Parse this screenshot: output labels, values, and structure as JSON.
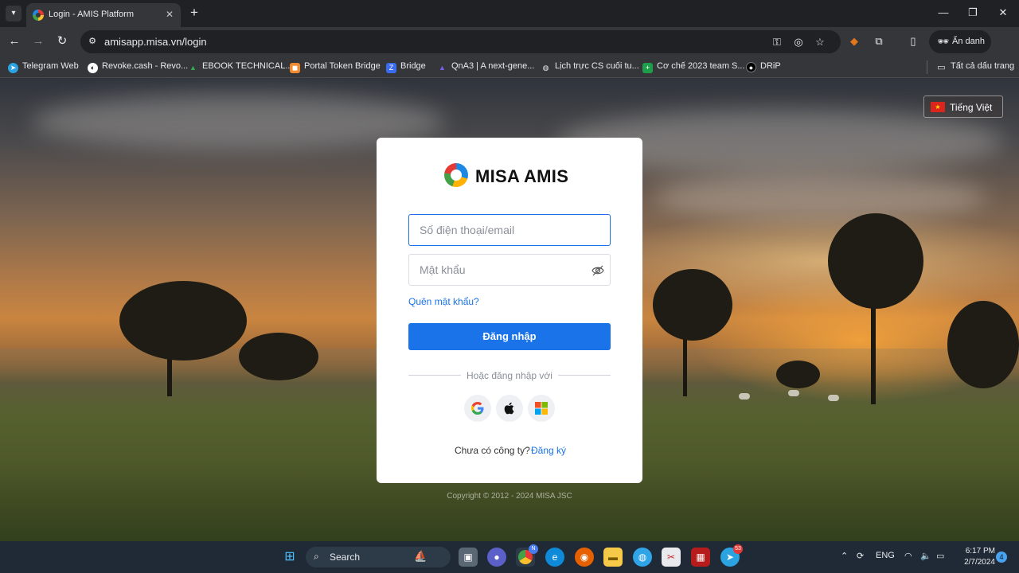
{
  "browser": {
    "tab_title": "Login - AMIS Platform",
    "url": "amisapp.misa.vn/login",
    "incognito_label": "Ẩn danh",
    "bookmarks": [
      {
        "label": "Telegram Web",
        "icon_color": "#2aa3e0",
        "glyph": "➤"
      },
      {
        "label": "Revoke.cash - Revo...",
        "icon_color": "#ffffff",
        "glyph": "◐"
      },
      {
        "label": "EBOOK TECHNICAL...",
        "icon_color": "#34a853",
        "glyph": "▲"
      },
      {
        "label": "Portal Token Bridge",
        "icon_color": "#f28b30",
        "glyph": "◼"
      },
      {
        "label": "Bridge",
        "icon_color": "#3b6cf0",
        "glyph": "Z"
      },
      {
        "label": "QnA3 | A next-gene...",
        "icon_color": "#5b3fd0",
        "glyph": "▲"
      },
      {
        "label": "Lịch trực CS cuối tu...",
        "icon_color": "#e8eaed",
        "glyph": "◍"
      },
      {
        "label": "Cơ chế 2023 team S...",
        "icon_color": "#1e9e4a",
        "glyph": "+"
      },
      {
        "label": "DRiP",
        "icon_color": "#000000",
        "glyph": "●"
      }
    ],
    "all_bookmarks_label": "Tất cả dấu trang"
  },
  "page": {
    "language_label": "Tiếng Việt",
    "logo_text": "MISA AMIS",
    "username_placeholder": "Số điện thoại/email",
    "username_value": "",
    "password_placeholder": "Mật khẩu",
    "password_value": "",
    "forgot_password": "Quên mật khẩu?",
    "login_button": "Đăng nhập",
    "divider_text": "Hoặc đăng nhập với",
    "signup_question": "Chưa có công ty?",
    "signup_link": "Đăng ký",
    "copyright": "Copyright © 2012 - 2024 MISA JSC"
  },
  "taskbar": {
    "search_label": "Search",
    "language": "ENG",
    "time": "6:17 PM",
    "date": "2/7/2024",
    "notification_count": "4",
    "chrome_badge": "N",
    "telegram_badge": "53"
  },
  "colors": {
    "primary": "#1a73e8",
    "chrome_dark": "#202124",
    "chrome_mid": "#35363a"
  }
}
